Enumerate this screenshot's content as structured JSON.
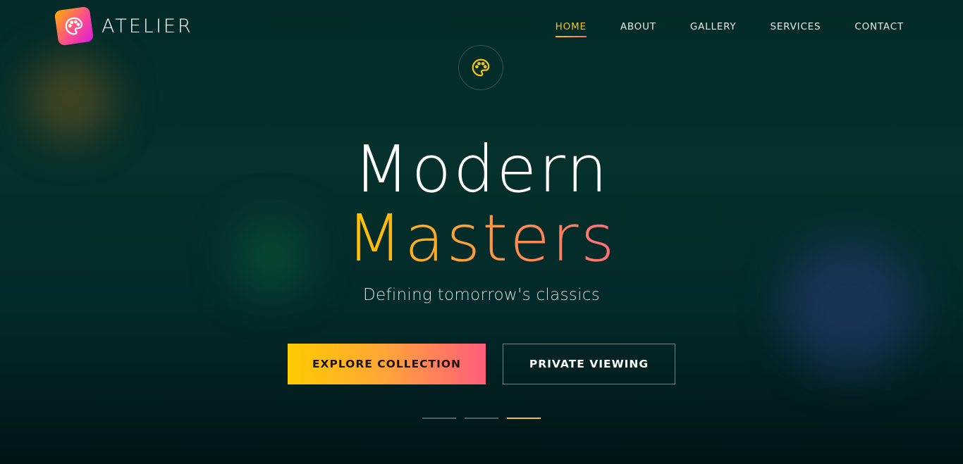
{
  "brand": {
    "name": "ATELIER",
    "icon": "palette-icon",
    "colors": {
      "gradient_start": "#ffb000",
      "gradient_mid": "#ff4d8d",
      "gradient_end": "#d41bdc"
    }
  },
  "nav": {
    "items": [
      {
        "label": "HOME",
        "active": true
      },
      {
        "label": "ABOUT",
        "active": false
      },
      {
        "label": "GALLERY",
        "active": false
      },
      {
        "label": "SERVICES",
        "active": false
      },
      {
        "label": "CONTACT",
        "active": false
      }
    ],
    "active_color": "#f7c21a"
  },
  "hero": {
    "emblem_icon": "palette-icon",
    "title_line1": "Modern",
    "title_line2": "Masters",
    "tagline": "Defining tomorrow's classics",
    "primary_button": "EXPLORE COLLECTION",
    "secondary_button": "PRIVATE VIEWING",
    "accent_colors": {
      "yellow": "#ffc400",
      "orange": "#ff9a3c",
      "pink": "#ff6d7a"
    }
  },
  "slider": {
    "count": 3,
    "active_index": 2
  }
}
